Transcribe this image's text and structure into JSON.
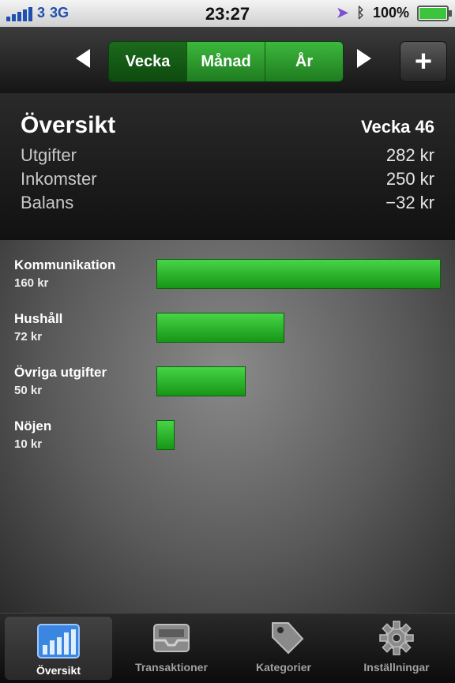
{
  "status_bar": {
    "carrier": "3",
    "network": "3G",
    "time": "23:27",
    "battery": "100%"
  },
  "nav": {
    "segments": [
      {
        "label": "Vecka",
        "selected": true
      },
      {
        "label": "Månad",
        "selected": false
      },
      {
        "label": "År",
        "selected": false
      }
    ],
    "add_label": "+"
  },
  "summary": {
    "title": "Översikt",
    "period": "Vecka 46",
    "rows": [
      {
        "label": "Utgifter",
        "value": "282 kr"
      },
      {
        "label": "Inkomster",
        "value": "250 kr"
      },
      {
        "label": "Balans",
        "value": "−32 kr"
      }
    ]
  },
  "chart_data": {
    "type": "bar",
    "categories": [
      "Kommunikation",
      "Hushåll",
      "Övriga utgifter",
      "Nöjen"
    ],
    "value_labels": [
      "160 kr",
      "72 kr",
      "50 kr",
      "10 kr"
    ],
    "values": [
      160,
      72,
      50,
      10
    ],
    "xlim": [
      0,
      160
    ],
    "color": "#2fb52f"
  },
  "tabs": [
    {
      "label": "Översikt",
      "icon": "chart-icon",
      "selected": true
    },
    {
      "label": "Transaktioner",
      "icon": "inbox-icon",
      "selected": false
    },
    {
      "label": "Kategorier",
      "icon": "tag-icon",
      "selected": false
    },
    {
      "label": "Inställningar",
      "icon": "gear-icon",
      "selected": false
    }
  ]
}
